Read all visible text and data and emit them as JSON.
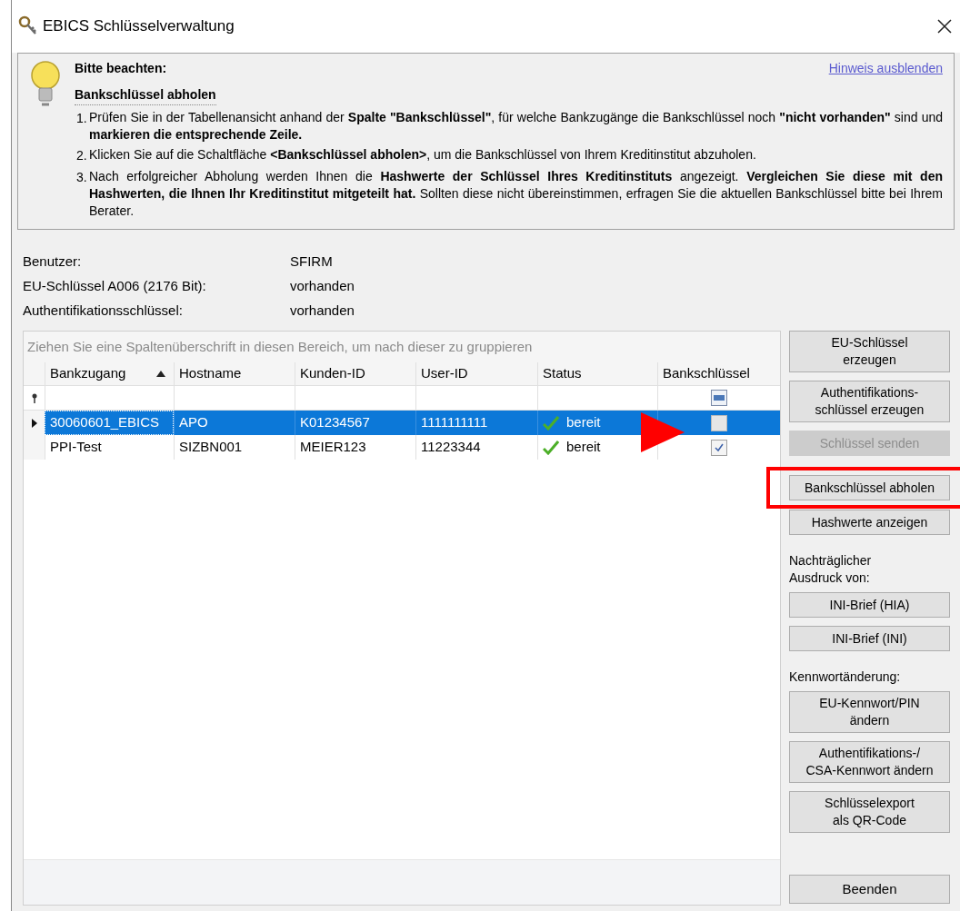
{
  "window": {
    "title": "EBICS Schlüsselverwaltung"
  },
  "hint": {
    "title": "Bitte beachten:",
    "link": "Hinweis ausblenden",
    "heading": "Bankschlüssel abholen",
    "steps": [
      {
        "number": "1.",
        "text": "Prüfen Sie in der Tabellenansicht anhand der **Spalte \"Bankschlüssel\"**, für welche Bankzugänge die Bankschlüssel noch **\"nicht vorhanden\"** sind und **markieren die entsprechende Zeile.**"
      },
      {
        "number": "2.",
        "text": "Klicken Sie auf die Schaltfläche **<Bankschlüssel abholen>**, um die Bankschlüssel von Ihrem Kreditinstitut abzuholen."
      },
      {
        "number": "3.",
        "text": "Nach erfolgreicher Abholung werden Ihnen die **Hashwerte der Schlüssel Ihres Kreditinstituts** angezeigt. **Vergleichen Sie diese mit den Hashwerten, die Ihnen Ihr Kreditinstitut mitgeteilt hat.** Sollten diese nicht übereinstimmen, erfragen Sie die aktuellen Bankschlüssel bitte bei Ihrem Berater."
      }
    ]
  },
  "info": [
    {
      "label": "Benutzer:",
      "value": "SFIRM"
    },
    {
      "label": "EU-Schlüssel A006 (2176 Bit):",
      "value": "vorhanden"
    },
    {
      "label": "Authentifikationsschlüssel:",
      "value": "vorhanden"
    }
  ],
  "table": {
    "group_hint": "Ziehen Sie eine Spaltenüberschrift in diesen Bereich, um nach dieser zu gruppieren",
    "columns": [
      {
        "label": "Bankzugang",
        "sorted": true
      },
      {
        "label": "Hostname",
        "sorted": false
      },
      {
        "label": "Kunden-ID",
        "sorted": false
      },
      {
        "label": "User-ID",
        "sorted": false
      },
      {
        "label": "Status",
        "sorted": false
      },
      {
        "label": "Bankschlüssel",
        "sorted": false
      }
    ],
    "rows": [
      {
        "selected": true,
        "cells": [
          "30060601_EBICS",
          "APO",
          "K01234567",
          "1111111111",
          "bereit"
        ],
        "bank_key": false
      },
      {
        "selected": false,
        "cells": [
          "PPI-Test",
          "SIZBN001",
          "MEIER123",
          "11223344",
          "bereit"
        ],
        "bank_key": true
      }
    ]
  },
  "side": [
    {
      "kind": "button",
      "label": "EU-Schlüssel\nerzeugen",
      "disabled": false,
      "highlighted": false
    },
    {
      "kind": "button",
      "label": "Authentifikations-\nschlüssel erzeugen",
      "disabled": false,
      "highlighted": false
    },
    {
      "kind": "button",
      "label": "Schlüssel senden",
      "disabled": true,
      "highlighted": false
    },
    {
      "kind": "button",
      "label": "Bankschlüssel abholen",
      "disabled": false,
      "highlighted": true
    },
    {
      "kind": "button",
      "label": "Hashwerte anzeigen",
      "disabled": false,
      "highlighted": false
    },
    {
      "kind": "label",
      "label": "Nachträglicher\nAusdruck von:"
    },
    {
      "kind": "button",
      "label": "INI-Brief (HIA)",
      "disabled": false,
      "highlighted": false
    },
    {
      "kind": "button",
      "label": "INI-Brief (INI)",
      "disabled": false,
      "highlighted": false
    },
    {
      "kind": "label",
      "label": "Kennwortänderung:"
    },
    {
      "kind": "button",
      "label": "EU-Kennwort/PIN\nändern",
      "disabled": false,
      "highlighted": false
    },
    {
      "kind": "button",
      "label": "Authentifikations-/\nCSA-Kennwort ändern",
      "disabled": false,
      "highlighted": false
    },
    {
      "kind": "button",
      "label": "Schlüsselexport\nals QR-Code",
      "disabled": false,
      "highlighted": false
    }
  ],
  "close_button": {
    "label": "Beenden"
  }
}
